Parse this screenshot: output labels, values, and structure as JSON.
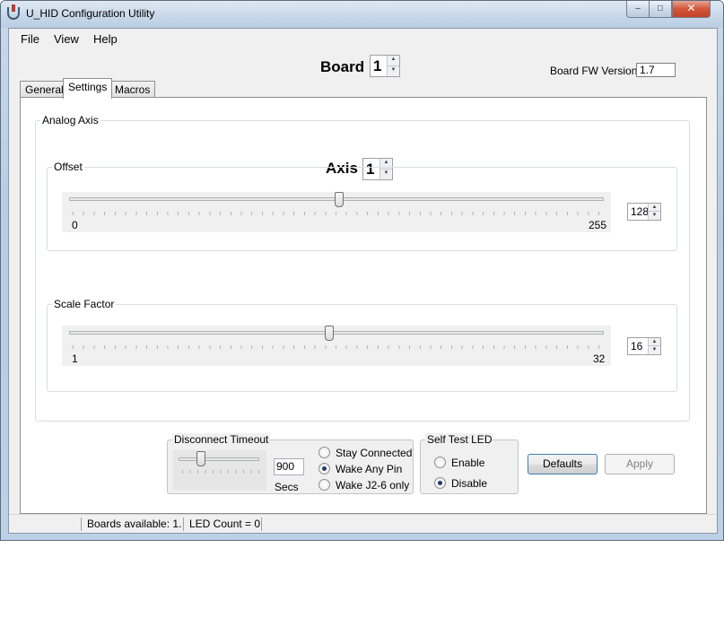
{
  "window": {
    "title": "U_HID Configuration Utility",
    "minimize": "–",
    "maximize": "□",
    "close": "✕"
  },
  "menu": {
    "items": [
      "File",
      "View",
      "Help"
    ]
  },
  "board": {
    "label": "Board",
    "value": "1",
    "fw_label": "Board FW Version",
    "fw_value": "1.7"
  },
  "tabs": [
    "General",
    "Settings",
    "Macros"
  ],
  "active_tab": "Settings",
  "analog_axis": {
    "title": "Analog Axis",
    "axis_label": "Axis",
    "axis_value": "1",
    "offset": {
      "title": "Offset",
      "min": "0",
      "max": "255",
      "value": "128"
    },
    "scale": {
      "title": "Scale Factor",
      "min": "1",
      "max": "32",
      "value": "16"
    }
  },
  "disconnect": {
    "title": "Disconnect Timeout",
    "seconds": "900",
    "secs_label": "Secs",
    "options": [
      "Stay Connected",
      "Wake Any Pin",
      "Wake J2-6 only"
    ],
    "selected": "Wake Any Pin",
    "slider_level": 0.25
  },
  "self_test": {
    "title": "Self Test LED",
    "options": [
      "Enable",
      "Disable"
    ],
    "selected": "Disable"
  },
  "buttons": {
    "defaults": "Defaults",
    "apply": "Apply"
  },
  "status": {
    "segment1": "",
    "boards": "Boards available: 1.",
    "led": "LED Count = 0"
  },
  "icons": {
    "spin_up": "▲",
    "spin_down": "▼"
  }
}
